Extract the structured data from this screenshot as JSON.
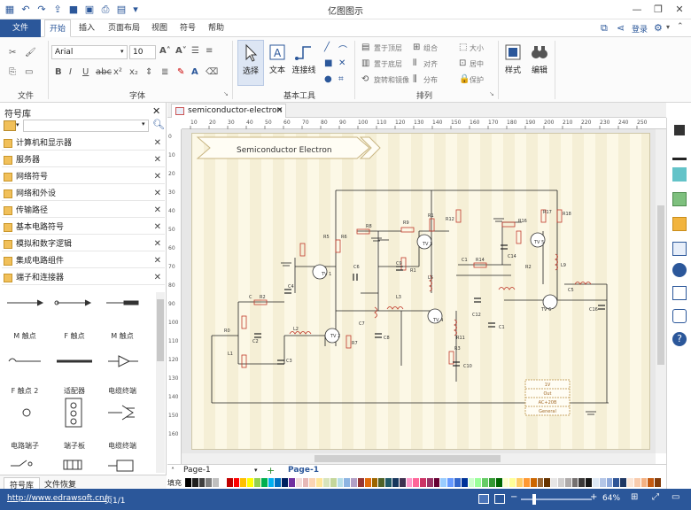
{
  "app": {
    "title": "亿图图示"
  },
  "quick_access": [
    "save-icon",
    "undo-icon",
    "redo-icon",
    "export-icon",
    "image-icon",
    "print-icon",
    "print-preview-icon",
    "more-icon"
  ],
  "window": {
    "user_label": "登录"
  },
  "menu": {
    "file": "文件",
    "tabs": [
      "开始",
      "插入",
      "页面布局",
      "视图",
      "符号",
      "帮助"
    ]
  },
  "ribbon": {
    "font_name": "Arial",
    "font_size": "10",
    "group_file": "文件",
    "group_font": "字体",
    "group_tools": "基本工具",
    "group_arrange": "排列",
    "btn_select": "选择",
    "btn_text": "文本",
    "btn_connector": "连接线",
    "btn_style": "样式",
    "btn_edit": "编辑",
    "arr_front": "置于顶层",
    "arr_back": "置于底层",
    "arr_rotate": "旋转和镜像",
    "arr_group": "组合",
    "arr_align": "对齐",
    "arr_distribute": "分布",
    "arr_size": "大小",
    "arr_center": "居中",
    "arr_protect": "保护"
  },
  "library": {
    "title": "符号库",
    "items": [
      "计算机和显示器",
      "服务器",
      "网络符号",
      "网络和外设",
      "传输路径",
      "基本电路符号",
      "模拟和数字逻辑",
      "集成电路组件",
      "端子和连接器"
    ],
    "shapes": [
      "M 触点",
      "F 触点",
      "M 触点",
      "F 触点 2",
      "适配器",
      "电缆终端",
      "电路端子",
      "端子板",
      "电缆终端"
    ],
    "bottom_tabs": [
      "符号库",
      "文件恢复"
    ]
  },
  "document": {
    "tab_name": "semiconductor-electron",
    "banner_title": "Semiconductor Electron",
    "ruler_top": [
      "10",
      "20",
      "30",
      "40",
      "50",
      "60",
      "70",
      "80",
      "90",
      "100",
      "110",
      "120",
      "130",
      "140",
      "150",
      "160",
      "170",
      "180",
      "190",
      "200",
      "210",
      "220",
      "230",
      "240",
      "250"
    ],
    "ruler_left": [
      "0",
      "10",
      "20",
      "30",
      "40",
      "50",
      "60",
      "70",
      "80",
      "90",
      "100",
      "110",
      "120",
      "130",
      "140",
      "150",
      "160"
    ],
    "components": {
      "resistors": [
        "R1",
        "R2",
        "R3",
        "R4",
        "R5",
        "R6",
        "R7",
        "R8",
        "R9",
        "R10",
        "R11",
        "R12",
        "R13",
        "R14",
        "R15",
        "R16",
        "R17",
        "R18",
        "R0"
      ],
      "capacitors": [
        "C",
        "C1",
        "C2",
        "C3",
        "C4",
        "C5",
        "C6",
        "C7",
        "C8",
        "C9",
        "C10",
        "C11",
        "C12",
        "C14",
        "C16"
      ],
      "transistors": [
        "TV 1",
        "TV 2",
        "TV 3",
        "TV 4",
        "TV 5",
        "TV 6",
        "TV 7"
      ],
      "inductors": [
        "L1",
        "L2",
        "L3",
        "L6",
        "L7",
        "L8",
        "L9"
      ],
      "misc_labels": [
        "1",
        "1",
        "2",
        "2",
        "3",
        "3",
        "4",
        "5",
        "6",
        "7",
        "8",
        "9"
      ]
    },
    "terminal_box": [
      "1V",
      "Out",
      "AC+20B",
      "General"
    ]
  },
  "pagebar": {
    "page_selector": "Page-1",
    "active_page": "Page-1"
  },
  "colorbar": {
    "label": "填充"
  },
  "status": {
    "url": "http://www.edrawsoft.cn/",
    "page_info": "页1/1",
    "zoom": "64%"
  }
}
